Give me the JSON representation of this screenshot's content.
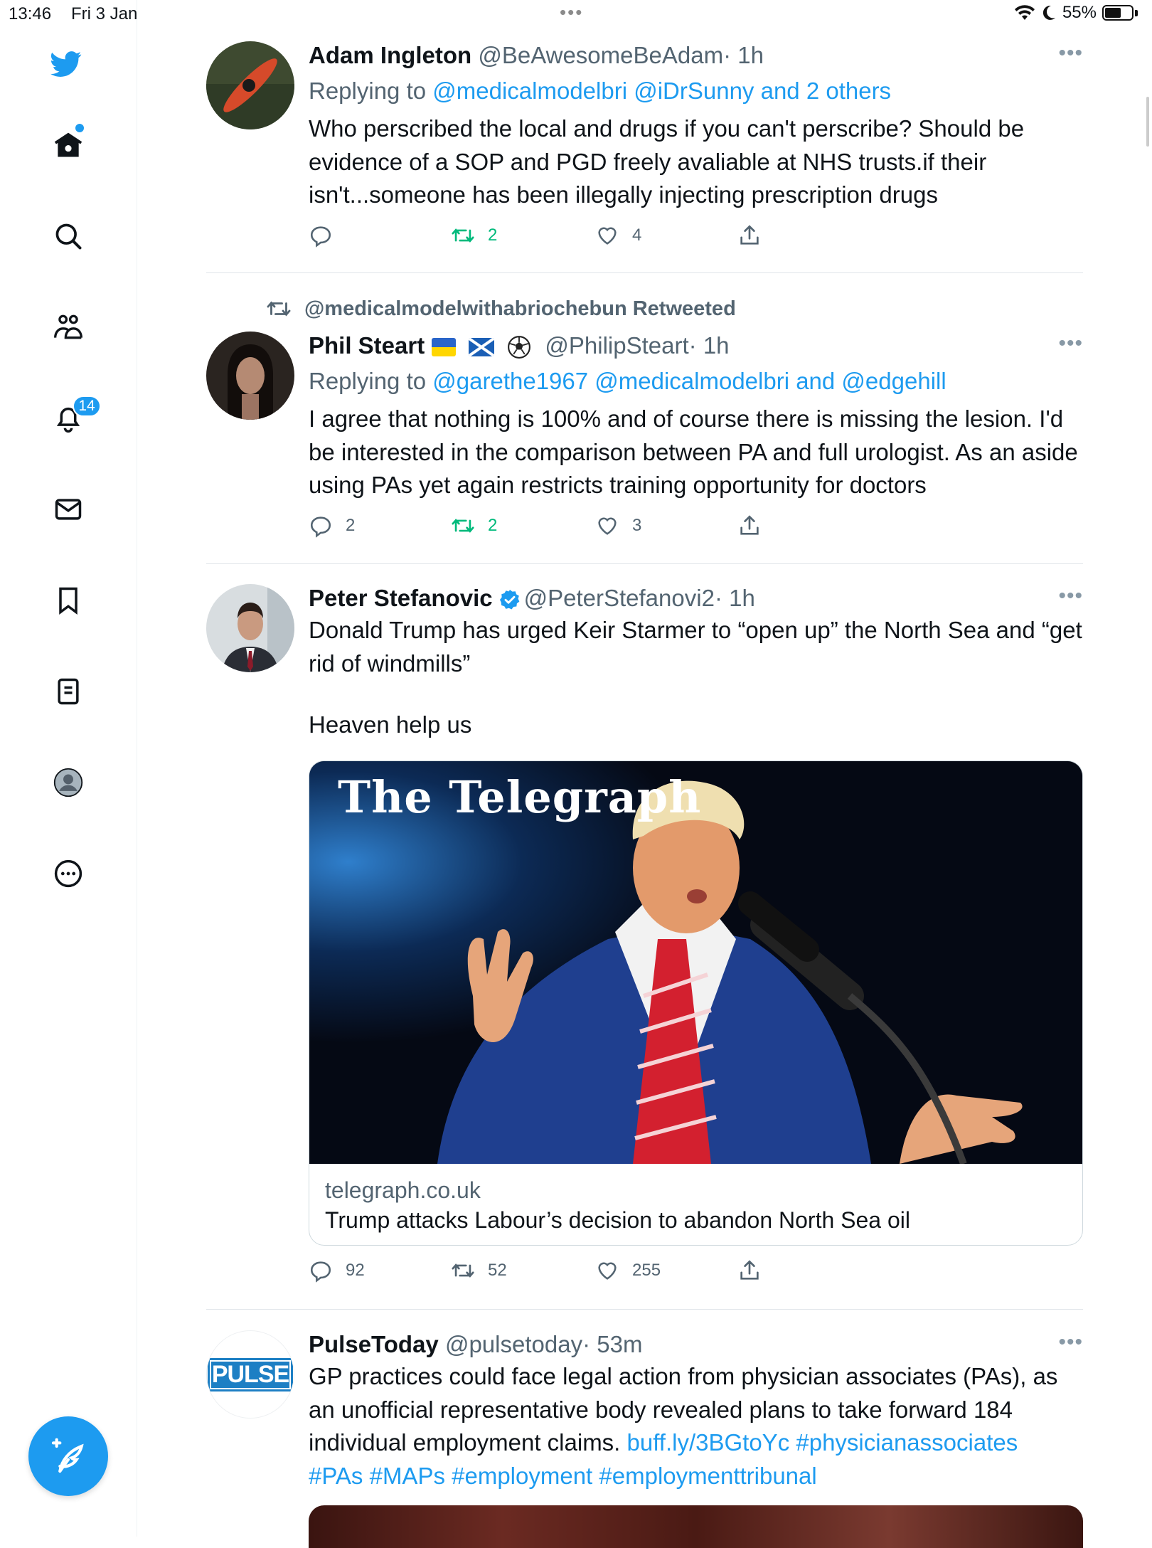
{
  "status_bar": {
    "time": "13:46",
    "date": "Fri 3 Jan",
    "battery": "55%"
  },
  "sidebar": {
    "notifications_badge": "14"
  },
  "tweets": [
    {
      "name": "Adam Ingleton",
      "handle": "@BeAwesomeBeAdam",
      "time": "· 1h",
      "replying_prefix": "Replying to ",
      "replying_to": "@medicalmodelbri @iDrSunny and 2 others",
      "text": "Who perscribed the local and drugs if you can't perscribe? Should be evidence of a SOP and PGD freely avaliable at NHS trusts.if their isn't...someone has been illegally injecting prescription drugs",
      "replies": "",
      "retweets": "2",
      "likes": "4"
    },
    {
      "retweeted_by": "@medicalmodelwithabriochebun Retweeted",
      "name": "Phil Steart",
      "handle": "@PhilipSteart",
      "time": "· 1h",
      "replying_prefix": "Replying to ",
      "replying_to": "@garethe1967 @medicalmodelbri and @edgehill",
      "text": "I agree that nothing is 100% and of course there is missing the lesion. I'd be interested in the comparison between PA and full urologist. As an aside using PAs yet again restricts training opportunity for doctors",
      "replies": "2",
      "retweets": "2",
      "likes": "3"
    },
    {
      "name": "Peter Stefanovic",
      "handle": "@PeterStefanovi2",
      "time": "· 1h",
      "text_line1": "Donald Trump has urged Keir Starmer to “open up” the North Sea and “get rid of windmills”",
      "text_line2": "Heaven help us",
      "card": {
        "image_brand": "The Telegraph",
        "domain": "telegraph.co.uk",
        "title": "Trump attacks Labour’s decision to abandon North Sea oil"
      },
      "replies": "92",
      "retweets": "52",
      "likes": "255"
    },
    {
      "name": "PulseToday",
      "handle": "@pulsetoday",
      "time": "· 53m",
      "avatar_text": "PULSE",
      "text": "GP practices could face legal action from physician associates (PAs), as an unofficial representative body revealed plans to take forward 184 individual employment claims. ",
      "link": "buff.ly/3BGtoYc",
      "hashtags_line1": " #physicianassociates",
      "hashtags_line2": "#PAs #MAPs #employment #employmenttribunal"
    }
  ]
}
